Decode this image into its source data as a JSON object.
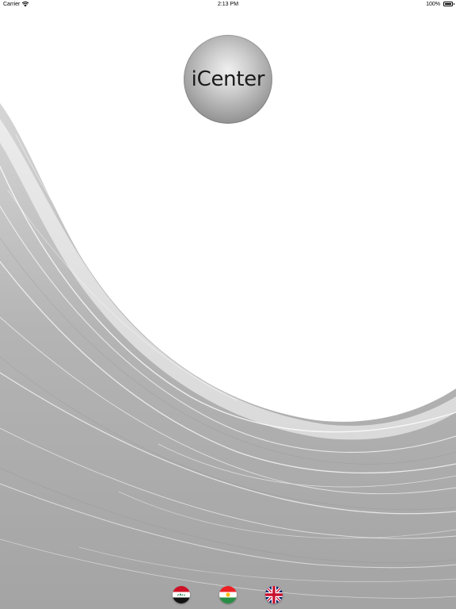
{
  "status_bar": {
    "carrier": "Carrier",
    "time": "2:13 PM",
    "battery": "100%",
    "wifi_icon": "wifi-icon",
    "battery_icon": "battery-icon"
  },
  "logo": {
    "text": "iCenter"
  },
  "languages": [
    {
      "name": "Arabic",
      "icon": "iraq-flag-icon"
    },
    {
      "name": "Kurdish",
      "icon": "kurdistan-flag-icon"
    },
    {
      "name": "English",
      "icon": "uk-flag-icon"
    }
  ],
  "colors": {
    "background": "#ffffff",
    "swoosh": "#a8a8a8",
    "logo_dark": "#6f6f6f",
    "logo_light": "#f0f0f0"
  }
}
